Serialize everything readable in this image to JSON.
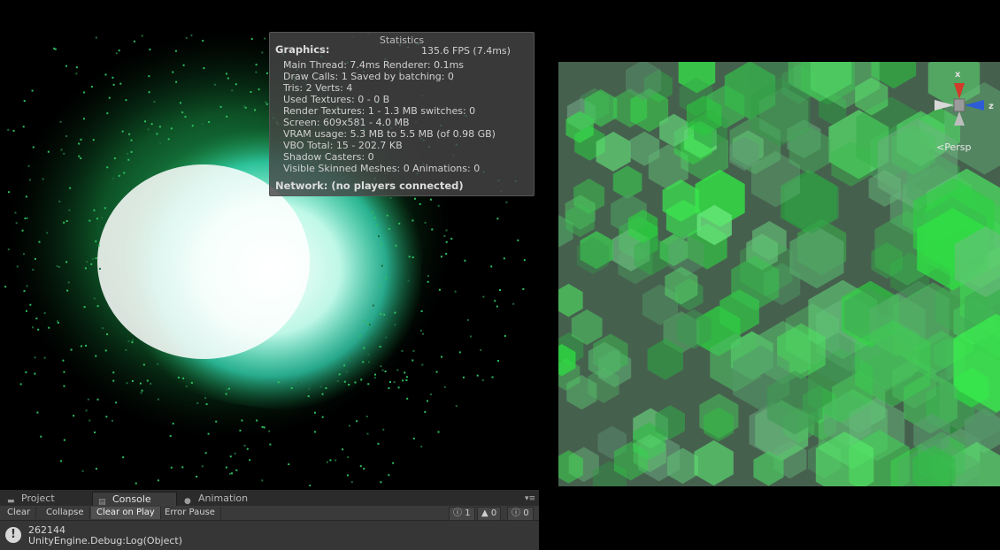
{
  "statistics": {
    "title": "Statistics",
    "graphics_label": "Graphics:",
    "fps": "135.6 FPS (7.4ms)",
    "lines": [
      "Main Thread: 7.4ms  Renderer: 0.1ms",
      "Draw Calls: 1   Saved by batching: 0",
      "Tris: 2       Verts: 4",
      "Used Textures: 0 - 0 B",
      "Render Textures: 1 - 1.3 MB switches: 0",
      "Screen: 609x581 - 4.0 MB",
      "VRAM usage: 5.3 MB to 5.5 MB (of 0.98 GB)",
      "VBO Total: 15 - 202.7 KB",
      "Shadow Casters: 0",
      "Visible Skinned Meshes: 0       Animations: 0"
    ],
    "network": "Network: (no players connected)"
  },
  "scene": {
    "gizmo_x": "x",
    "gizmo_z": "z",
    "projection": "Persp"
  },
  "console": {
    "tabs": [
      "Project",
      "Console",
      "Animation"
    ],
    "toolbar": [
      "Clear",
      "Collapse",
      "Clear on Play",
      "Error Pause"
    ],
    "counts": {
      "log": "1",
      "warning": "0",
      "error": "0"
    },
    "entry": {
      "line1": "262144",
      "line2": "UnityEngine.Debug:Log(Object)"
    }
  },
  "colors": {
    "particle_green": "#3ad86a",
    "particle_white": "#e8fff8",
    "scene_bg": "#4e6a56"
  }
}
